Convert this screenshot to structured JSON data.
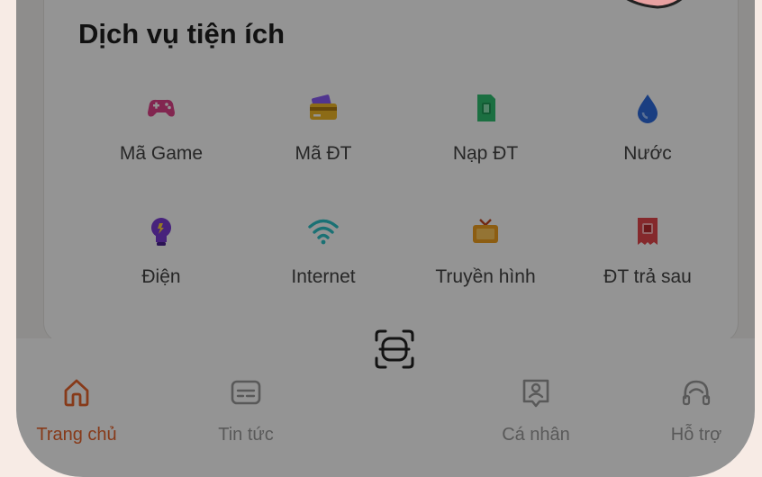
{
  "section": {
    "title": "Dịch vụ tiện ích"
  },
  "services": [
    {
      "label": "Mã Game",
      "icon": "gamepad-icon",
      "color": "#e0428a"
    },
    {
      "label": "Mã ĐT",
      "icon": "phone-card-icon",
      "color": "#f2b827"
    },
    {
      "label": "Nạp ĐT",
      "icon": "sim-topup-icon",
      "color": "#2fbf71"
    },
    {
      "label": "Nước",
      "icon": "water-drop-icon",
      "color": "#2d6cdf"
    },
    {
      "label": "Điện",
      "icon": "lightbulb-icon",
      "color": "#7a3bd6"
    },
    {
      "label": "Internet",
      "icon": "wifi-icon",
      "color": "#2ec3c9"
    },
    {
      "label": "Truyền hình",
      "icon": "tv-icon",
      "color": "#f2a020"
    },
    {
      "label": "ĐT trả sau",
      "icon": "postpaid-bill-icon",
      "color": "#e5484d"
    }
  ],
  "nav": {
    "items": [
      {
        "label": "Trang chủ",
        "icon": "home-icon",
        "active": true
      },
      {
        "label": "Tin tức",
        "icon": "news-icon",
        "active": false
      },
      {
        "label": "Cá nhân",
        "icon": "profile-icon",
        "active": false
      },
      {
        "label": "Hỗ trợ",
        "icon": "support-icon",
        "active": false
      }
    ],
    "scan_icon": "scan-qr-icon",
    "active_color": "#e8642c",
    "inactive_color": "#9a9a9a"
  }
}
